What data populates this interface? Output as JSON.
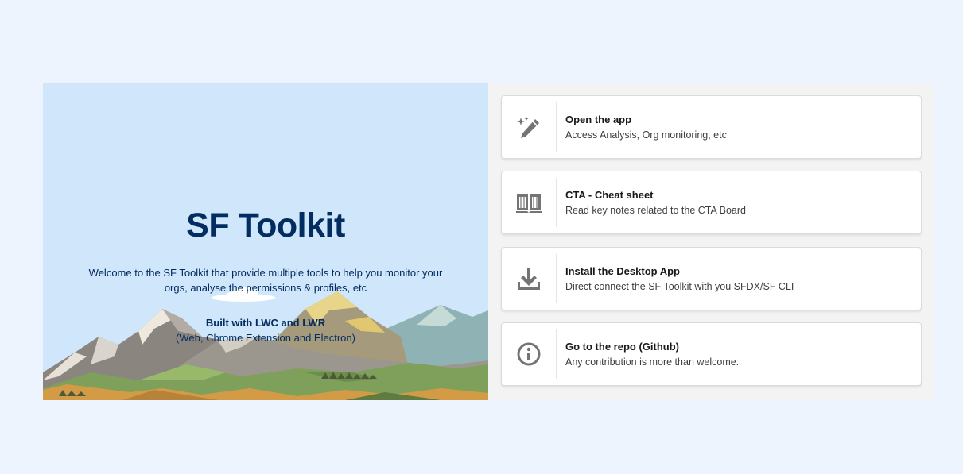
{
  "hero": {
    "title": "SF Toolkit",
    "description": "Welcome to the SF Toolkit that provide multiple tools to help you monitor your orgs, analyse the permissions & profiles, etc",
    "built_with": "Built with LWC and LWR",
    "platforms": "(Web, Chrome Extension and Electron)"
  },
  "cards": [
    {
      "title": "Open the app",
      "subtitle": "Access Analysis, Org monitoring, etc",
      "icon": "magic-wand-icon"
    },
    {
      "title": "CTA - Cheat sheet",
      "subtitle": "Read key notes related to the CTA Board",
      "icon": "book-icon"
    },
    {
      "title": "Install the Desktop App",
      "subtitle": "Direct connect the SF Toolkit with you SFDX/SF CLI",
      "icon": "download-icon"
    },
    {
      "title": "Go to the repo (Github)",
      "subtitle": "Any contribution is more than welcome.",
      "icon": "info-icon"
    }
  ],
  "colors": {
    "page_bg": "#eef4fe",
    "hero_bg": "#cfe6fb",
    "hero_text": "#032d60",
    "panel_bg": "#f3f3f3",
    "icon": "#747474"
  }
}
